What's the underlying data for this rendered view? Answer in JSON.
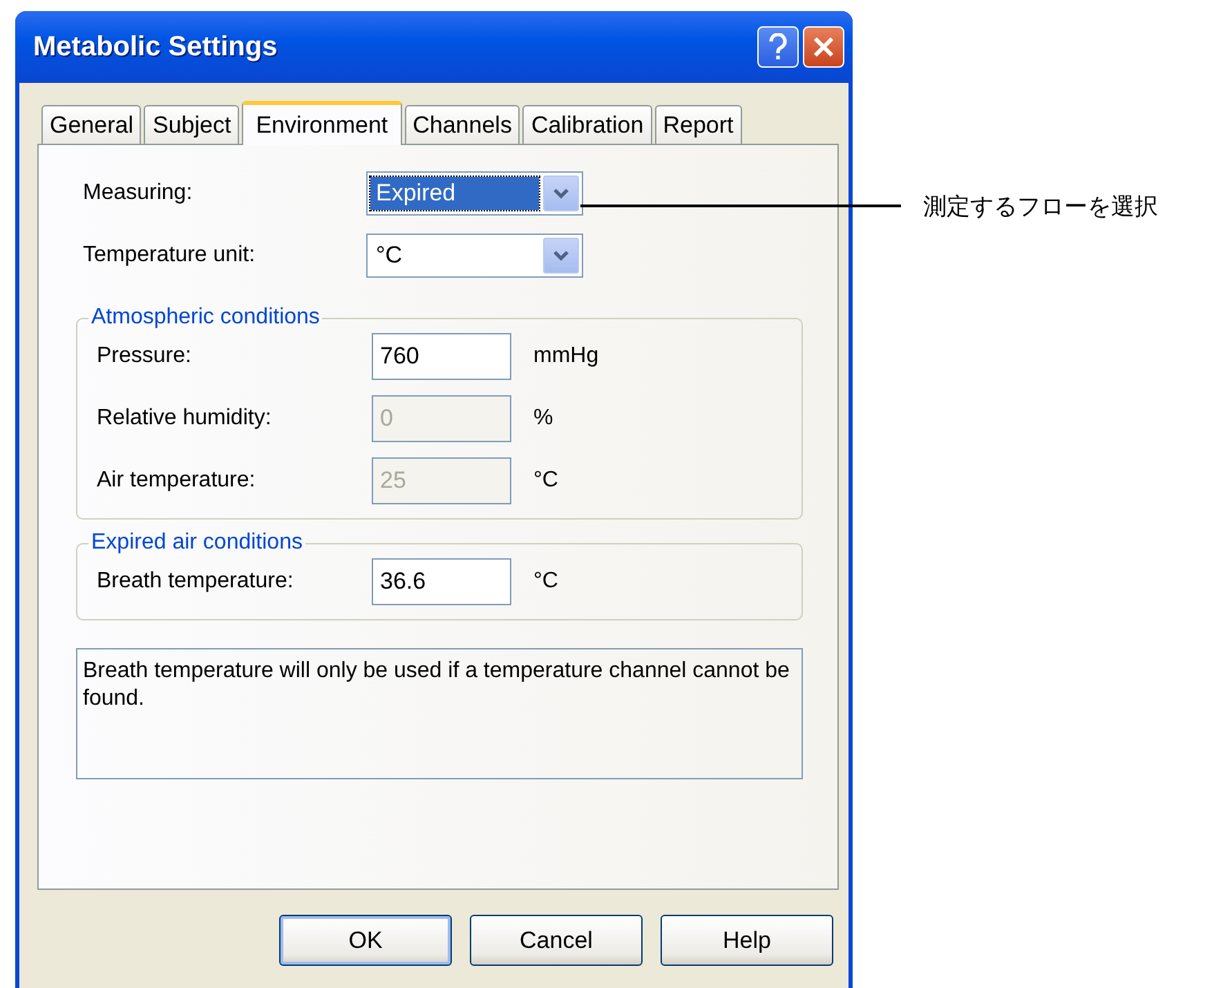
{
  "window": {
    "title": "Metabolic Settings"
  },
  "tabs": [
    {
      "label": "General",
      "selected": false
    },
    {
      "label": "Subject",
      "selected": false
    },
    {
      "label": "Environment",
      "selected": true
    },
    {
      "label": "Channels",
      "selected": false
    },
    {
      "label": "Calibration",
      "selected": false
    },
    {
      "label": "Report",
      "selected": false
    }
  ],
  "dropdowns": [
    {
      "label": "Measuring:",
      "value": "Expired",
      "focused": true
    },
    {
      "label": "Temperature unit:",
      "value": "°C",
      "focused": false
    }
  ],
  "groups": [
    {
      "title": "Atmospheric conditions",
      "fields": [
        {
          "label": "Pressure:",
          "value": "760",
          "unit": "mmHg",
          "disabled": false
        },
        {
          "label": "Relative humidity:",
          "value": "0",
          "unit": "%",
          "disabled": true
        },
        {
          "label": "Air temperature:",
          "value": "25",
          "unit": "°C",
          "disabled": true
        }
      ]
    },
    {
      "title": "Expired air conditions",
      "fields": [
        {
          "label": "Breath temperature:",
          "value": "36.6",
          "unit": "°C",
          "disabled": false
        }
      ]
    }
  ],
  "info_text": "Breath temperature will only be used if a temperature channel cannot be found.",
  "buttons": [
    {
      "label": "OK",
      "default": true
    },
    {
      "label": "Cancel",
      "default": false
    },
    {
      "label": "Help",
      "default": false
    }
  ],
  "annotation": {
    "text": "測定するフローを選択"
  }
}
